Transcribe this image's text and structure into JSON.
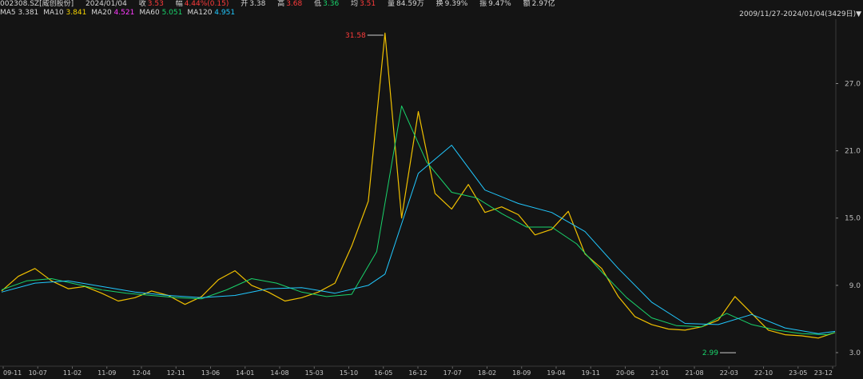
{
  "header": {
    "code": "002308.SZ[威创股份]",
    "date": "2024/01/04",
    "close_label": "收",
    "close": "3.53",
    "chg_label": "幅",
    "chg": "4.44%(0.15)",
    "open_label": "开",
    "open": "3.38",
    "high_label": "高",
    "high": "3.68",
    "low_label": "低",
    "low": "3.36",
    "avg_label": "均",
    "avg": "3.51",
    "vol_label": "量",
    "vol": "84.59万",
    "turn_label": "换",
    "turn": "9.39%",
    "amp_label": "振",
    "amp": "9.47%",
    "amt_label": "额",
    "amt": "2.97亿",
    "range": "2009/11/27-2024/01/04(3429日)",
    "range_arrow": "▼"
  },
  "ma": [
    {
      "label": "MA5",
      "value": "3.381",
      "color": "#d6d6d6"
    },
    {
      "label": "MA10",
      "value": "3.841",
      "color": "#f5d300"
    },
    {
      "label": "MA20",
      "value": "4.521",
      "color": "#ff3bff"
    },
    {
      "label": "MA60",
      "value": "5.051",
      "color": "#19d36b"
    },
    {
      "label": "MA120",
      "value": "4.951",
      "color": "#21c8ff"
    }
  ],
  "chart_data": {
    "type": "line",
    "title": "",
    "ylim": [
      2.5,
      31.6
    ],
    "y_ticks": [
      "3.0",
      "9.0",
      "15.0",
      "21.0",
      "27.0"
    ],
    "y_tick_values": [
      3,
      9,
      15,
      21,
      27
    ],
    "x_ticks": [
      "09-11",
      "10-07",
      "11-02",
      "11-09",
      "12-04",
      "12-11",
      "13-06",
      "14-01",
      "14-08",
      "15-03",
      "15-10",
      "16-05",
      "16-12",
      "17-07",
      "18-02",
      "18-09",
      "19-04",
      "19-11",
      "20-06",
      "21-01",
      "21-08",
      "22-03",
      "22-10",
      "23-05",
      "23-12"
    ],
    "annotations": [
      {
        "text": "31.58",
        "value": 31.58,
        "color": "#ff3b3b"
      },
      {
        "text": "2.99",
        "value": 2.99,
        "color": "#19d36b"
      }
    ],
    "series": [
      {
        "color": "#f0c000",
        "x": [
          0,
          2,
          4,
          6,
          8,
          10,
          12,
          14,
          16,
          18,
          20,
          22,
          24,
          26,
          28,
          30,
          32,
          34,
          36,
          38,
          40,
          42,
          44,
          46,
          48,
          50,
          52,
          54,
          56,
          58,
          60,
          62,
          64,
          66,
          68,
          70,
          72,
          74,
          76,
          78,
          80,
          82,
          84,
          86,
          88,
          90,
          92,
          94,
          96,
          98,
          100
        ],
        "y": [
          8.5,
          9.8,
          10.5,
          9.4,
          8.7,
          8.9,
          8.3,
          7.6,
          7.9,
          8.5,
          8.1,
          7.3,
          8.0,
          9.5,
          10.3,
          9.0,
          8.4,
          7.6,
          7.9,
          8.4,
          9.2,
          12.5,
          16.5,
          31.5,
          15.0,
          24.5,
          17.2,
          15.8,
          18.0,
          15.5,
          16.0,
          15.3,
          13.5,
          14.0,
          15.6,
          11.8,
          10.5,
          8.0,
          6.2,
          5.5,
          5.1,
          5.0,
          5.3,
          5.9,
          8.0,
          6.5,
          5.0,
          4.6,
          4.5,
          4.3,
          4.8
        ]
      },
      {
        "color": "#19d36b",
        "x": [
          0,
          3,
          6,
          9,
          12,
          15,
          18,
          21,
          24,
          27,
          30,
          33,
          36,
          39,
          42,
          45,
          48,
          51,
          54,
          57,
          60,
          63,
          66,
          69,
          72,
          75,
          78,
          81,
          84,
          87,
          90,
          93,
          96,
          99,
          100
        ],
        "y": [
          8.6,
          9.4,
          9.6,
          9.1,
          8.6,
          8.3,
          8.1,
          7.9,
          7.8,
          8.6,
          9.6,
          9.2,
          8.4,
          8.0,
          8.2,
          12.0,
          25.0,
          20.0,
          17.3,
          16.8,
          15.4,
          14.2,
          14.2,
          12.7,
          10.2,
          7.9,
          6.1,
          5.4,
          5.3,
          6.5,
          5.5,
          5.0,
          4.7,
          4.6,
          4.8
        ]
      },
      {
        "color": "#21c8ff",
        "x": [
          0,
          4,
          8,
          12,
          16,
          20,
          24,
          28,
          32,
          36,
          40,
          44,
          46,
          50,
          54,
          58,
          62,
          66,
          70,
          74,
          78,
          82,
          86,
          90,
          94,
          98,
          100
        ],
        "y": [
          8.4,
          9.2,
          9.4,
          8.9,
          8.4,
          8.1,
          7.9,
          8.1,
          8.7,
          8.8,
          8.3,
          9.0,
          10.0,
          19.0,
          21.5,
          17.5,
          16.3,
          15.5,
          13.8,
          10.5,
          7.5,
          5.6,
          5.5,
          6.4,
          5.2,
          4.7,
          4.9
        ]
      }
    ]
  }
}
